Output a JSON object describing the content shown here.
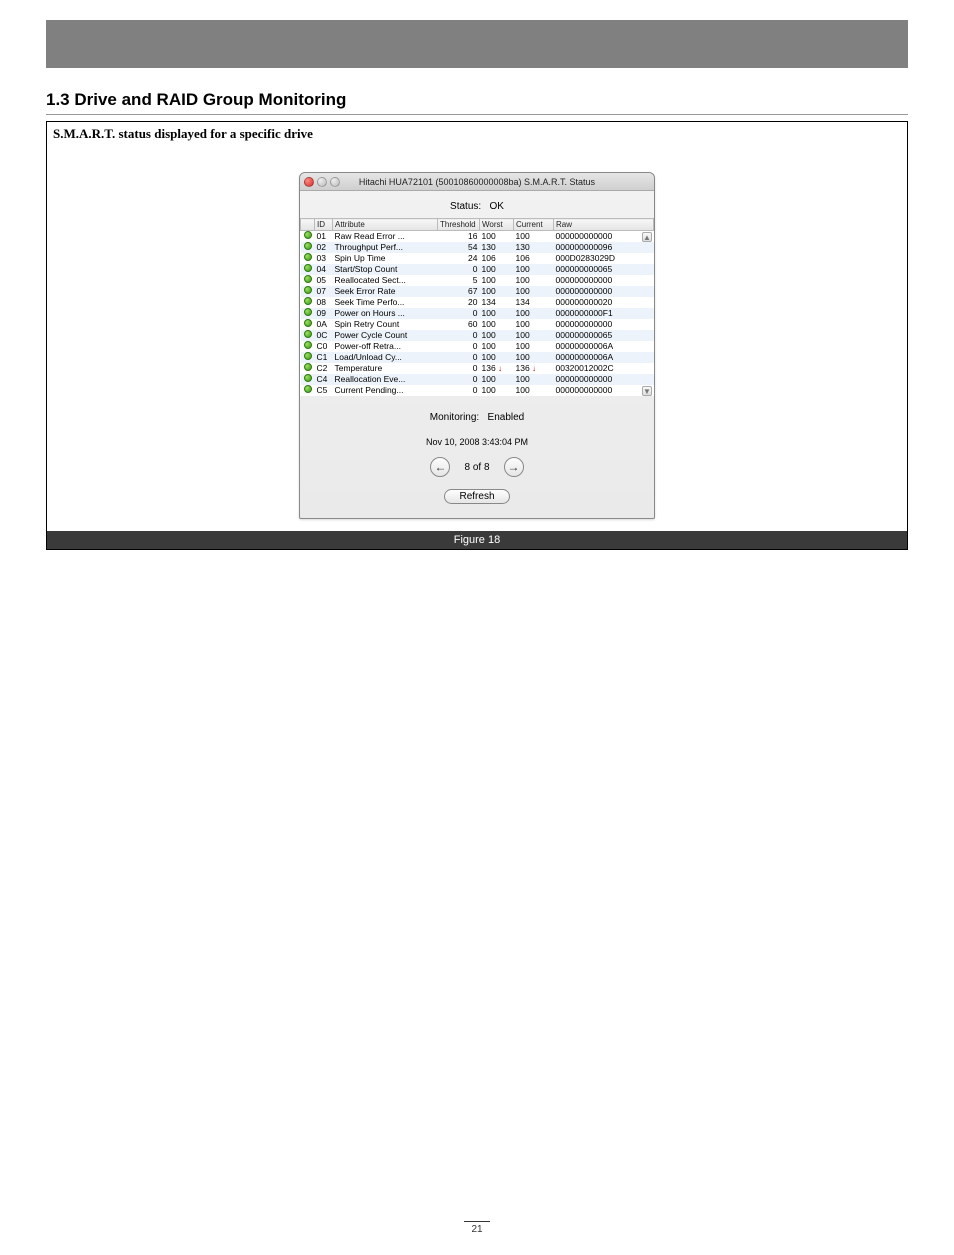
{
  "section_heading": "1.3 Drive and RAID Group Monitoring",
  "figure_title": "S.M.A.R.T. status displayed for a specific drive",
  "figure_caption": "Figure 18",
  "page_number": "21",
  "window": {
    "title": "Hitachi HUA72101 (50010860000008ba) S.M.A.R.T. Status",
    "status_label": "Status:",
    "status_value": "OK",
    "monitoring_label": "Monitoring:",
    "monitoring_value": "Enabled",
    "timestamp": "Nov 10, 2008 3:43:04 PM",
    "pager": "8 of 8",
    "refresh_label": "Refresh",
    "columns": [
      "",
      "ID",
      "Attribute",
      "Threshold",
      "Worst",
      "Current",
      "Raw"
    ],
    "rows": [
      {
        "id": "01",
        "attr": "Raw Read Error ...",
        "thresh": "16",
        "worst": "100",
        "current": "100",
        "raw": "000000000000",
        "flag": ""
      },
      {
        "id": "02",
        "attr": "Throughput Perf...",
        "thresh": "54",
        "worst": "130",
        "current": "130",
        "raw": "000000000096",
        "flag": ""
      },
      {
        "id": "03",
        "attr": "Spin Up Time",
        "thresh": "24",
        "worst": "106",
        "current": "106",
        "raw": "000D0283029D",
        "flag": ""
      },
      {
        "id": "04",
        "attr": "Start/Stop Count",
        "thresh": "0",
        "worst": "100",
        "current": "100",
        "raw": "000000000065",
        "flag": ""
      },
      {
        "id": "05",
        "attr": "Reallocated Sect...",
        "thresh": "5",
        "worst": "100",
        "current": "100",
        "raw": "000000000000",
        "flag": ""
      },
      {
        "id": "07",
        "attr": "Seek Error Rate",
        "thresh": "67",
        "worst": "100",
        "current": "100",
        "raw": "000000000000",
        "flag": ""
      },
      {
        "id": "08",
        "attr": "Seek Time Perfo...",
        "thresh": "20",
        "worst": "134",
        "current": "134",
        "raw": "000000000020",
        "flag": ""
      },
      {
        "id": "09",
        "attr": "Power on Hours ...",
        "thresh": "0",
        "worst": "100",
        "current": "100",
        "raw": "0000000000F1",
        "flag": ""
      },
      {
        "id": "0A",
        "attr": "Spin Retry Count",
        "thresh": "60",
        "worst": "100",
        "current": "100",
        "raw": "000000000000",
        "flag": ""
      },
      {
        "id": "0C",
        "attr": "Power Cycle Count",
        "thresh": "0",
        "worst": "100",
        "current": "100",
        "raw": "000000000065",
        "flag": ""
      },
      {
        "id": "C0",
        "attr": "Power-off Retra...",
        "thresh": "0",
        "worst": "100",
        "current": "100",
        "raw": "00000000006A",
        "flag": ""
      },
      {
        "id": "C1",
        "attr": "Load/Unload Cy...",
        "thresh": "0",
        "worst": "100",
        "current": "100",
        "raw": "00000000006A",
        "flag": ""
      },
      {
        "id": "C2",
        "attr": "Temperature",
        "thresh": "0",
        "worst": "136",
        "current": "136",
        "raw": "00320012002C",
        "flag": "down"
      },
      {
        "id": "C4",
        "attr": "Reallocation Eve...",
        "thresh": "0",
        "worst": "100",
        "current": "100",
        "raw": "000000000000",
        "flag": ""
      },
      {
        "id": "C5",
        "attr": "Current Pending...",
        "thresh": "0",
        "worst": "100",
        "current": "100",
        "raw": "000000000000",
        "flag": ""
      }
    ]
  }
}
